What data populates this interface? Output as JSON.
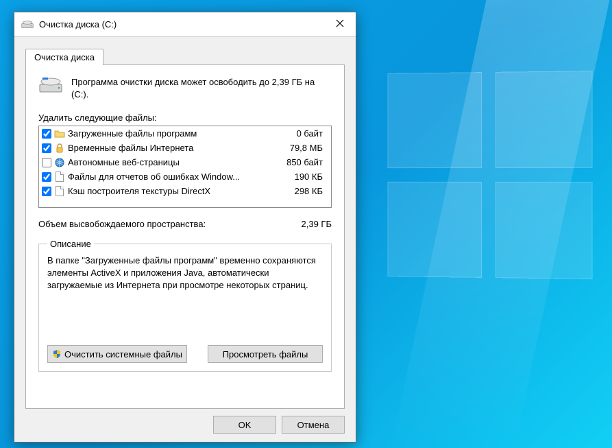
{
  "window": {
    "title": "Очистка диска  (C:)"
  },
  "tab": {
    "label": "Очистка диска"
  },
  "intro": {
    "message": "Программа очистки диска может освободить до 2,39 ГБ на (C:)."
  },
  "list": {
    "label": "Удалить следующие файлы:",
    "rows": [
      {
        "checked": true,
        "icon": "folder",
        "name": "Загруженные файлы программ",
        "size": "0 байт"
      },
      {
        "checked": true,
        "icon": "lock",
        "name": "Временные файлы Интернета",
        "size": "79,8 МБ"
      },
      {
        "checked": false,
        "icon": "globe",
        "name": "Автономные веб-страницы",
        "size": "850 байт"
      },
      {
        "checked": true,
        "icon": "page",
        "name": "Файлы для отчетов об ошибках Window...",
        "size": "190 КБ"
      },
      {
        "checked": true,
        "icon": "page",
        "name": "Кэш построителя текстуры DirectX",
        "size": "298 КБ"
      }
    ]
  },
  "total": {
    "label": "Объем высвобождаемого пространства:",
    "value": "2,39 ГБ"
  },
  "description": {
    "legend": "Описание",
    "text": "В папке \"Загруженные файлы программ\" временно сохраняются элементы ActiveX и приложения Java, автоматически загружаемые из Интернета при просмотре некоторых страниц."
  },
  "buttons": {
    "clean_system": "Очистить системные файлы",
    "view_files": "Просмотреть файлы",
    "ok": "OK",
    "cancel": "Отмена"
  }
}
